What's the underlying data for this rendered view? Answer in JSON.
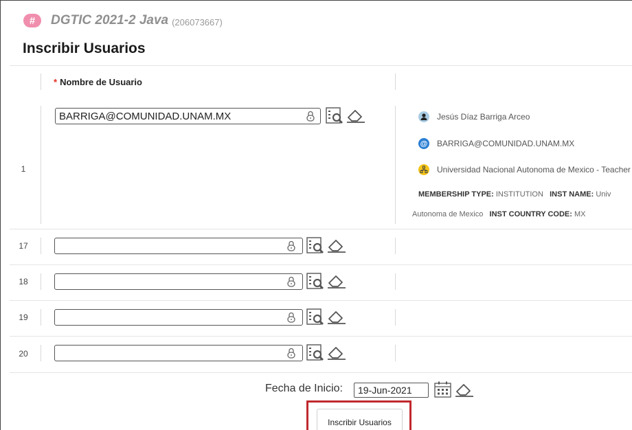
{
  "course": {
    "logo_glyph": "#",
    "title": "DGTIC 2021-2 Java",
    "id": "(206073667)"
  },
  "page_title": "Inscribir Usuarios",
  "table": {
    "required_marker": "*",
    "username_header": "Nombre de Usuario"
  },
  "rows": [
    {
      "number": "1",
      "value": "BARRIGA@COMUNIDAD.UNAM.MX"
    },
    {
      "number": "17",
      "value": ""
    },
    {
      "number": "18",
      "value": ""
    },
    {
      "number": "19",
      "value": ""
    },
    {
      "number": "20",
      "value": ""
    }
  ],
  "user_details": {
    "name": "Jesús Díaz Barriga Arceo",
    "email": "BARRIGA@COMUNIDAD.UNAM.MX",
    "institution_role": "Universidad Nacional Autonoma de Mexico - Teacher",
    "membership_type_label": "MEMBERSHIP TYPE:",
    "membership_type_value": "INSTITUTION",
    "inst_name_label": "INST NAME:",
    "inst_name_value_start": "Univ",
    "inst_name_value_end": "Autonoma de Mexico",
    "inst_country_label": "INST COUNTRY CODE:",
    "inst_country_value": "MX"
  },
  "footer": {
    "start_date_label": "Fecha de Inicio:",
    "start_date_value": "19-Jun-2021",
    "submit_label": "Inscribir Usuarios"
  },
  "colors": {
    "logo_pink": "#f08eae",
    "required_red": "#e0301e",
    "highlight_red": "#c0282d",
    "person_badge": "#a9cce4",
    "email_badge": "#2a7fd4",
    "institution_badge": "#f5c518"
  },
  "icons": {
    "lock": "lock-icon",
    "search": "search-user-icon",
    "eraser": "eraser-icon",
    "calendar": "calendar-icon",
    "person": "person-icon",
    "email": "at-sign-icon",
    "institution": "institution-icon"
  }
}
